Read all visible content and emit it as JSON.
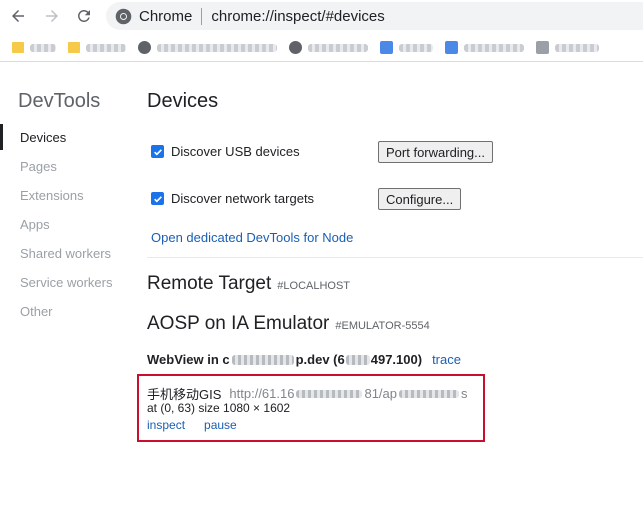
{
  "browser": {
    "site_name": "Chrome",
    "url": "chrome://inspect/#devices"
  },
  "sidebar": {
    "title": "DevTools",
    "items": [
      {
        "label": "Devices",
        "active": true
      },
      {
        "label": "Pages"
      },
      {
        "label": "Extensions"
      },
      {
        "label": "Apps"
      },
      {
        "label": "Shared workers"
      },
      {
        "label": "Service workers"
      },
      {
        "label": "Other"
      }
    ]
  },
  "main": {
    "title": "Devices",
    "discover_usb_label": "Discover USB devices",
    "discover_usb_checked": true,
    "port_forwarding_label": "Port forwarding...",
    "discover_network_label": "Discover network targets",
    "discover_network_checked": true,
    "configure_label": "Configure...",
    "node_link": "Open dedicated DevTools for Node",
    "remote_target_title": "Remote Target",
    "remote_target_sub": "#LOCALHOST",
    "device_title": "AOSP on IA Emulator",
    "device_sub": "#EMULATOR-5554",
    "webview_prefix": "WebView in c",
    "webview_mid": "p.dev (6",
    "webview_suffix": "497.100)",
    "trace_label": "trace",
    "target": {
      "title": "手机移动GIS",
      "url_start": "http://61.16",
      "url_mid": "81/ap",
      "url_end": "s",
      "position": "at (0, 63)  size 1080 × 1602",
      "inspect_label": "inspect",
      "pause_label": "pause"
    }
  },
  "colors": {
    "link": "#1a5fb4",
    "checkbox": "#1a73e8",
    "highlight_border": "#c8102e"
  },
  "icons": [
    "back-arrow-icon",
    "forward-arrow-icon",
    "reload-icon",
    "chrome-logo-icon",
    "checkmark-icon",
    "folder-icon",
    "globe-icon"
  ]
}
